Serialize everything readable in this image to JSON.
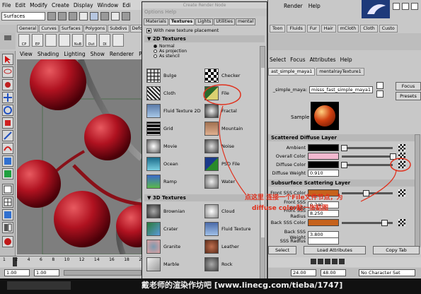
{
  "main_menu": [
    "File",
    "Edit",
    "Modify",
    "Create",
    "Display",
    "Window",
    "Edi"
  ],
  "mode_selector": "Surfaces",
  "shelf_tabs": [
    "General",
    "Curves",
    "Surfaces",
    "Polygons",
    "Subdivs",
    "Defo"
  ],
  "shelf_icons": [
    "CP",
    "EP",
    "",
    "",
    "NuB",
    "Out",
    "DI"
  ],
  "viewport_menu": [
    "View",
    "Shading",
    "Lighting",
    "Show",
    "Renderer",
    "Pane"
  ],
  "timeline": {
    "ticks": [
      "1",
      "2",
      "4",
      "6",
      "8",
      "10",
      "12",
      "14",
      "16",
      "18",
      "20"
    ],
    "current": "1.00"
  },
  "range": {
    "start": "1.00",
    "start2": "1.00"
  },
  "render_node": {
    "title": "Create Render Node",
    "menu": "Options  Help",
    "tabs": [
      "Materials",
      "Textures",
      "Lights",
      "Utilities",
      "mental"
    ],
    "active_tab": "Textures",
    "checkbox_label": "With new texture placement",
    "sec_2d": "2D Textures",
    "radios": [
      "Normal",
      "As projection",
      "As stencil"
    ],
    "textures_2d": [
      "Bulge",
      "Checker",
      "Cloth",
      "File",
      "Fluid Texture 2D",
      "Fractal",
      "Grid",
      "Mountain",
      "Movie",
      "Noise",
      "Ocean",
      "PSD File",
      "Ramp",
      "Water"
    ],
    "sec_3d": "3D Textures",
    "textures_3d": [
      "Brownian",
      "Cloud",
      "Crater",
      "Fluid Texture",
      "Granite",
      "Leather",
      "Marble",
      "Rock"
    ]
  },
  "attr": {
    "menu": [
      "Select",
      "Focus",
      "Attributes",
      "Help"
    ],
    "top_menu": [
      "Render",
      "Help"
    ],
    "tabs": [
      "Toon",
      "Fluids",
      "Fur",
      "Hair",
      "mCloth",
      "Cloth",
      "Custo"
    ],
    "node_tabs": [
      "ast_simple_maya1",
      "mentalrayTexture1"
    ],
    "shader_label": "_simple_maya:",
    "shader_name": "misss_fast_simple_maya1",
    "focus_btn": "Focus",
    "presets_btn": "Presets",
    "sample_label": "Sample",
    "scattered_head": "Scattered Diffuse Layer",
    "ambient_label": "Ambient",
    "overall_label": "Overall Color",
    "diffuse_label": "Diffuse Color",
    "diffuse_weight_label": "Diffuse Weight",
    "diffuse_weight": "0.910",
    "subsurface_head": "Subsurface Scattering Layer",
    "front_color_label": "Front SSS Color",
    "front_weight_label": "Front SSS Weight",
    "front_weight": "0.740",
    "front_radius_label": "Front SSS Radius",
    "front_radius": "8.250",
    "back_color_label": "Back SSS Color",
    "back_weight_label": "Back SSS Weight",
    "back_weight": "3.800",
    "back_radius_label": "SSS Radius",
    "select_btn": "Select",
    "load_btn": "Load Attributes",
    "copy_btn": "Copy Tab",
    "time1": "24.00",
    "time2": "48.00",
    "char_set": "No Character Set"
  },
  "annotation": {
    "line1": "点这里 连接一个File文件节点，为",
    "line2": "diffuse color贴一张贴图"
  },
  "watermark": "戴老师的渲染作坊吧 [www.linecg.com/tieba/1747]",
  "colors": {
    "ambient": "#000000",
    "overall": "#f2b8cf",
    "diffuse": "#000000",
    "front_sss": "#c6621c",
    "back_sss": "#c6621c",
    "sphere": "#b01220",
    "annotation": "#e0301c"
  }
}
